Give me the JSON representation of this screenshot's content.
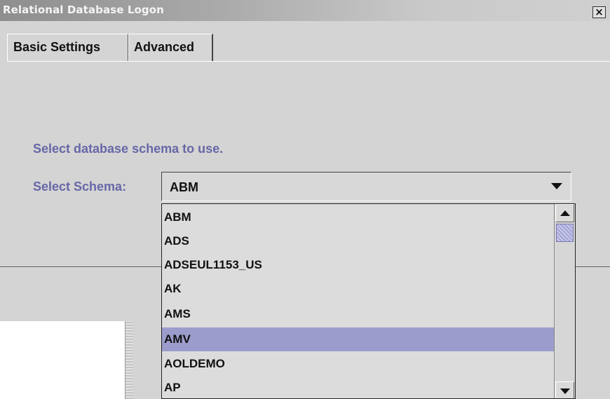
{
  "window": {
    "title": "Relational Database Logon",
    "close_label": "×"
  },
  "tabs": [
    {
      "label": "Basic Settings",
      "active": false
    },
    {
      "label": "Advanced",
      "active": true
    }
  ],
  "content": {
    "prompt": "Select database schema to use.",
    "schema_label": "Select Schema:"
  },
  "schema_select": {
    "selected_value": "ABM",
    "options": [
      "ABM",
      "ADS",
      "ADSEUL1153_US",
      "AK",
      "AMS",
      "AMV",
      "AOLDEMO",
      "AP"
    ],
    "highlighted": "AMV"
  },
  "colors": {
    "label_text": "#6767a7",
    "selection_highlight": "#9c9ccc",
    "scroll_thumb": "#a4a4d4"
  },
  "icons": {
    "close": "close-icon",
    "combo_arrow": "chevron-down-icon",
    "scroll_up": "scroll-up-arrow-icon",
    "scroll_down": "scroll-down-arrow-icon"
  }
}
